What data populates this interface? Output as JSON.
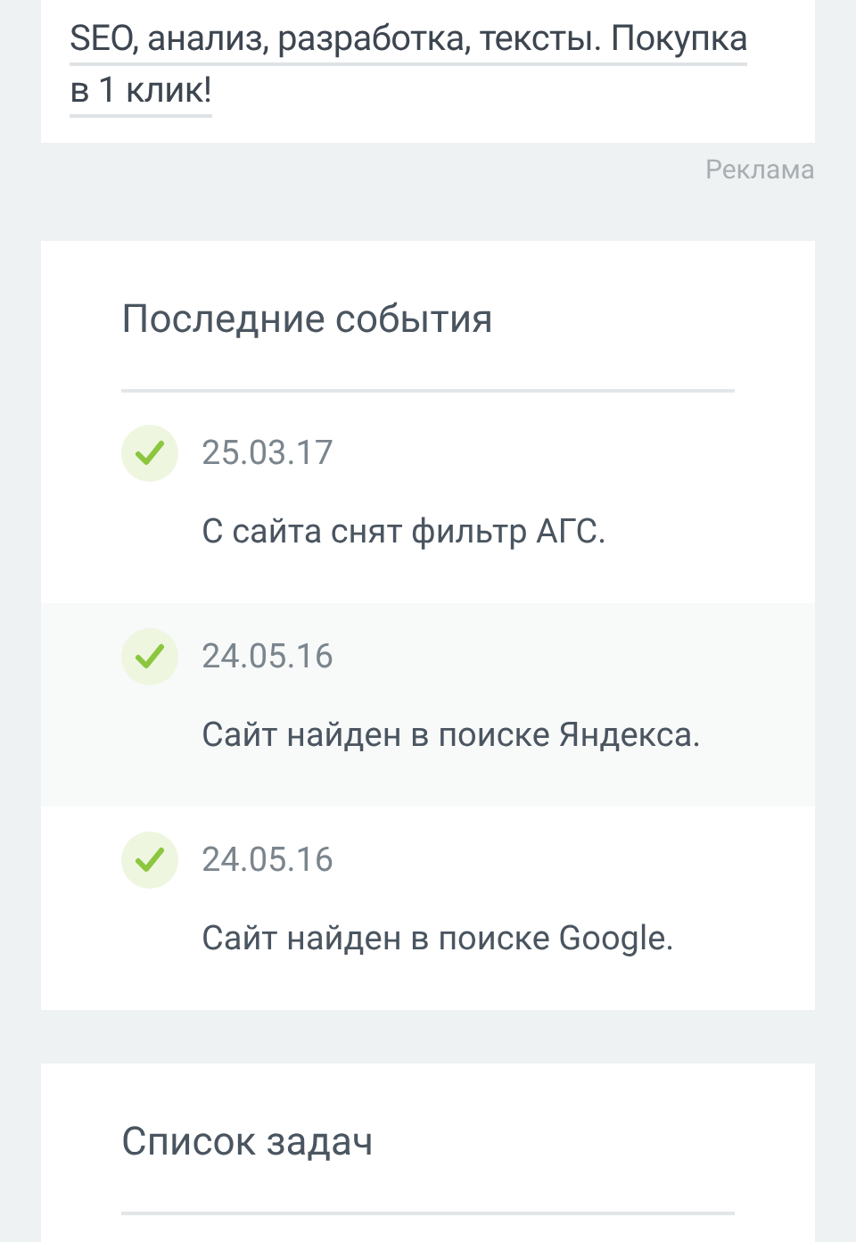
{
  "ad": {
    "link_lines": [
      "SEO, анализ, разработка, тексты. Покупка",
      "в 1 клик!"
    ],
    "label": "Реклама"
  },
  "events": {
    "title": "Последние события",
    "items": [
      {
        "date": "25.03.17",
        "text": "С сайта снят фильтр АГС."
      },
      {
        "date": "24.05.16",
        "text": "Сайт найден в поиске Яндекса."
      },
      {
        "date": "24.05.16",
        "text": "Сайт найден в поиске Google."
      }
    ]
  },
  "tasks": {
    "title": "Список задач"
  }
}
